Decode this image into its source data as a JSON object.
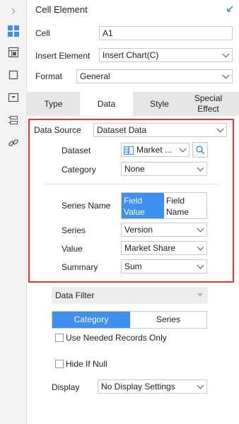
{
  "panel": {
    "title": "Cell Element"
  },
  "cell": {
    "label": "Cell",
    "value": "A1"
  },
  "insert_element": {
    "label": "Insert Element",
    "value": "Insert Chart(C)"
  },
  "format": {
    "label": "Format",
    "value": "General"
  },
  "tabs": [
    {
      "label": "Type"
    },
    {
      "label": "Data"
    },
    {
      "label": "Style"
    },
    {
      "label": "Special Effect"
    }
  ],
  "data_tab": {
    "data_source": {
      "label": "Data Source",
      "value": "Dataset Data"
    },
    "dataset": {
      "label": "Dataset",
      "value": "Market ..."
    },
    "category": {
      "label": "Category",
      "value": "None"
    },
    "series_name": {
      "label": "Series Name",
      "options": [
        "Field Value",
        "Field Name"
      ],
      "selected": "Field Value"
    },
    "series": {
      "label": "Series",
      "value": "Version"
    },
    "value": {
      "label": "Value",
      "value": "Market Share"
    },
    "summary": {
      "label": "Summary",
      "value": "Sum"
    }
  },
  "data_filter": {
    "label": "Data Filter",
    "segments": [
      "Category",
      "Series"
    ],
    "selected": "Category",
    "use_needed_records": "Use Needed Records Only",
    "hide_if_null": "Hide If Null"
  },
  "display": {
    "label": "Display",
    "value": "No Display Settings"
  },
  "colors": {
    "accent": "#3d8ff0",
    "highlight_box": "#e4363a",
    "tab_bar": "#e6e6e6",
    "rail": "#f3f3f3"
  }
}
